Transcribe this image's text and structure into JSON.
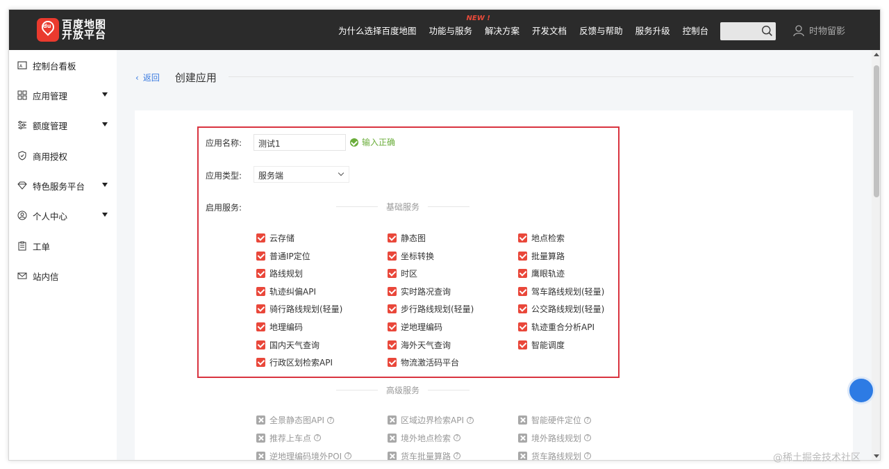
{
  "header": {
    "logo_line1": "百度地图",
    "logo_line2": "开放平台",
    "nav": [
      "为什么选择百度地图",
      "功能与服务",
      "解决方案",
      "开发文档",
      "反馈与帮助",
      "服务升级",
      "控制台"
    ],
    "nav_badge": "NEW !",
    "user_name": "时物留影"
  },
  "sidebar": {
    "items": [
      {
        "label": "控制台看板",
        "icon": "dashboard-icon",
        "has_caret": false
      },
      {
        "label": "应用管理",
        "icon": "grid-icon",
        "has_caret": true
      },
      {
        "label": "额度管理",
        "icon": "sliders-icon",
        "has_caret": true
      },
      {
        "label": "商用授权",
        "icon": "shield-icon",
        "has_caret": false
      },
      {
        "label": "特色服务平台",
        "icon": "diamond-icon",
        "has_caret": true
      },
      {
        "label": "个人中心",
        "icon": "user-circle-icon",
        "has_caret": true
      },
      {
        "label": "工单",
        "icon": "clipboard-icon",
        "has_caret": false
      },
      {
        "label": "站内信",
        "icon": "mail-icon",
        "has_caret": false
      }
    ]
  },
  "breadcrumb": {
    "back": "返回",
    "title": "创建应用"
  },
  "form": {
    "name_label": "应用名称:",
    "name_value": "测试1",
    "name_ok": "输入正确",
    "type_label": "应用类型:",
    "type_value": "服务端",
    "services_label": "启用服务:"
  },
  "basic_section": "基础服务",
  "basic_services": [
    "云存储",
    "静态图",
    "地点检索",
    "普通IP定位",
    "坐标转换",
    "批量算路",
    "路线规划",
    "时区",
    "鹰眼轨迹",
    "轨迹纠偏API",
    "实时路况查询",
    "驾车路线规划(轻量)",
    "骑行路线规划(轻量)",
    "步行路线规划(轻量)",
    "公交路线规划(轻量)",
    "地理编码",
    "逆地理编码",
    "轨迹重合分析API",
    "国内天气查询",
    "海外天气查询",
    "智能调度",
    "行政区划检索API",
    "物流激活码平台"
  ],
  "advanced_section": "高级服务",
  "advanced_services": [
    "全景静态图API",
    "区域边界检索API",
    "智能硬件定位",
    "推荐上车点",
    "境外地点检索",
    "境外路线规划",
    "逆地理编码境外POI",
    "货车批量算路",
    "货车路线规划"
  ],
  "watermark": "@稀土掘金技术社区",
  "colors": {
    "accent": "#e9473a",
    "nav_bg": "#2b2b2b",
    "ok": "#6aad3a",
    "link": "#3a7be0",
    "highlight": "#d9333f"
  }
}
